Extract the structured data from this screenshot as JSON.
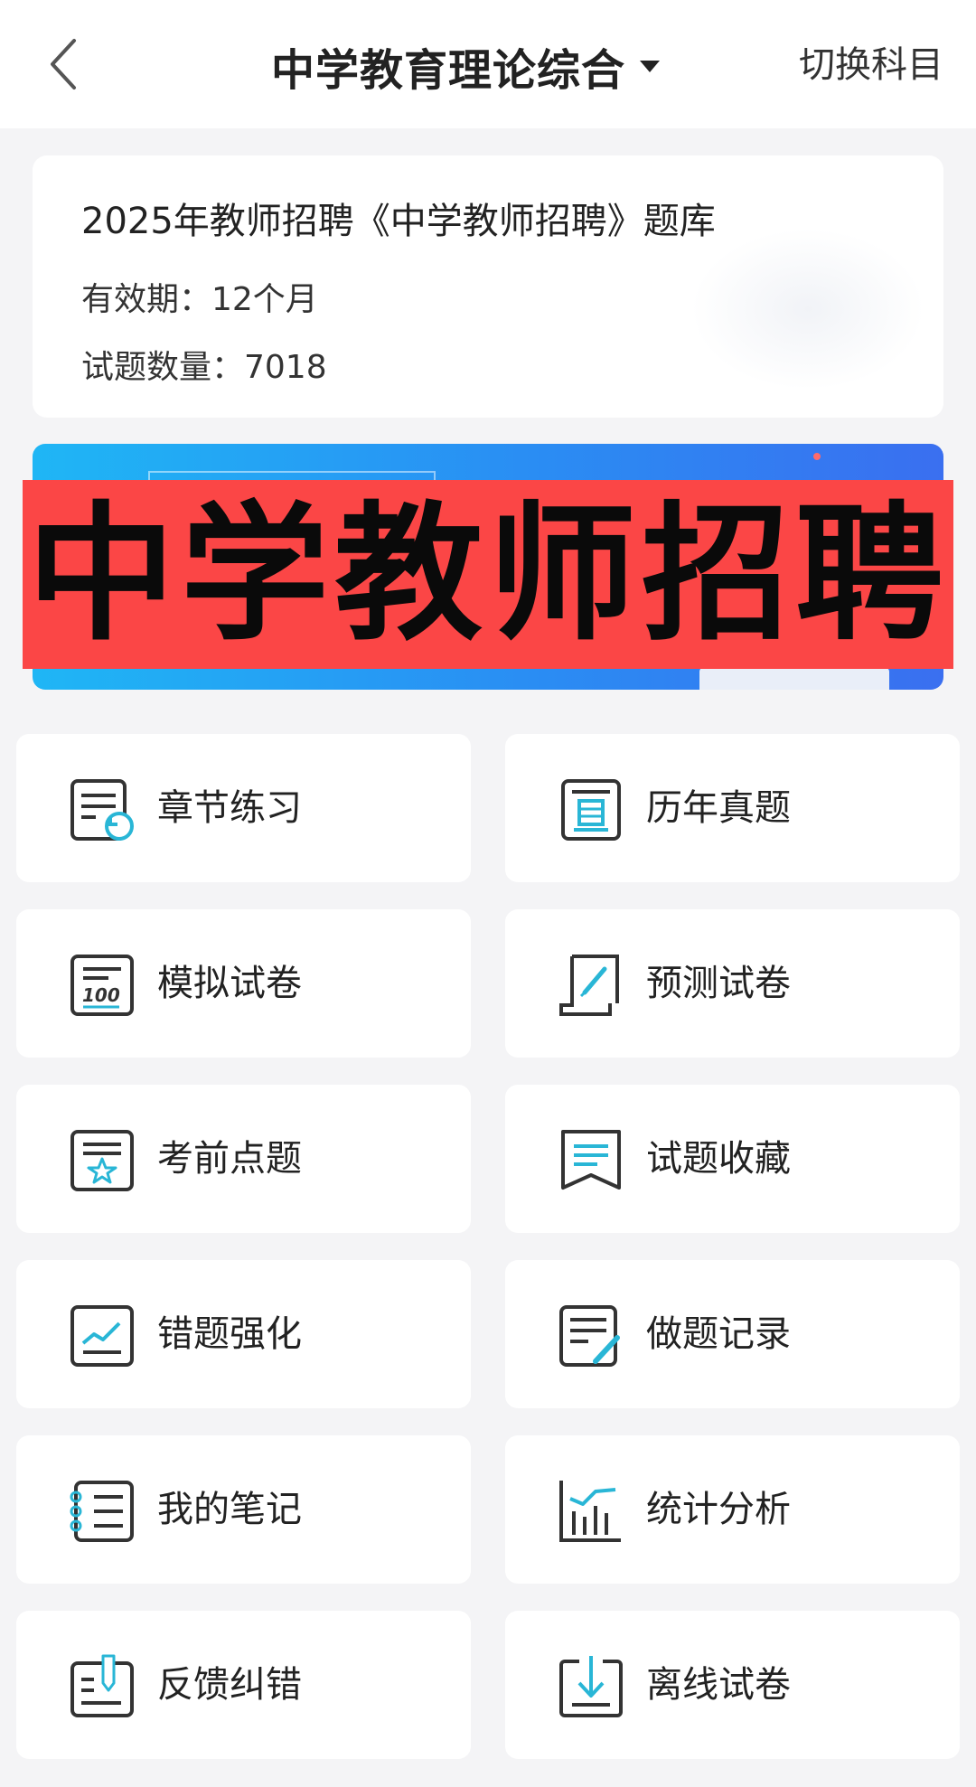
{
  "header": {
    "title": "中学教育理论综合",
    "switch_label": "切换科目"
  },
  "info": {
    "bank_title": "2025年教师招聘《中学教师招聘》题库",
    "validity": "有效期：12个月",
    "count": "试题数量：7018"
  },
  "banner": {
    "overlay_text": "中学教师招聘"
  },
  "menu": [
    {
      "label": "章节练习",
      "icon": "chapter-practice-icon"
    },
    {
      "label": "历年真题",
      "icon": "past-exams-icon"
    },
    {
      "label": "模拟试卷",
      "icon": "mock-exam-icon"
    },
    {
      "label": "预测试卷",
      "icon": "forecast-exam-icon"
    },
    {
      "label": "考前点题",
      "icon": "key-points-icon"
    },
    {
      "label": "试题收藏",
      "icon": "favorites-icon"
    },
    {
      "label": "错题强化",
      "icon": "wrong-questions-icon"
    },
    {
      "label": "做题记录",
      "icon": "history-record-icon"
    },
    {
      "label": "我的笔记",
      "icon": "notes-icon"
    },
    {
      "label": "统计分析",
      "icon": "statistics-icon"
    },
    {
      "label": "反馈纠错",
      "icon": "feedback-icon"
    },
    {
      "label": "离线试卷",
      "icon": "offline-download-icon"
    }
  ],
  "colors": {
    "accent": "#29b6d6",
    "overlay_red": "#fb4646",
    "icon_stroke": "#333333"
  }
}
